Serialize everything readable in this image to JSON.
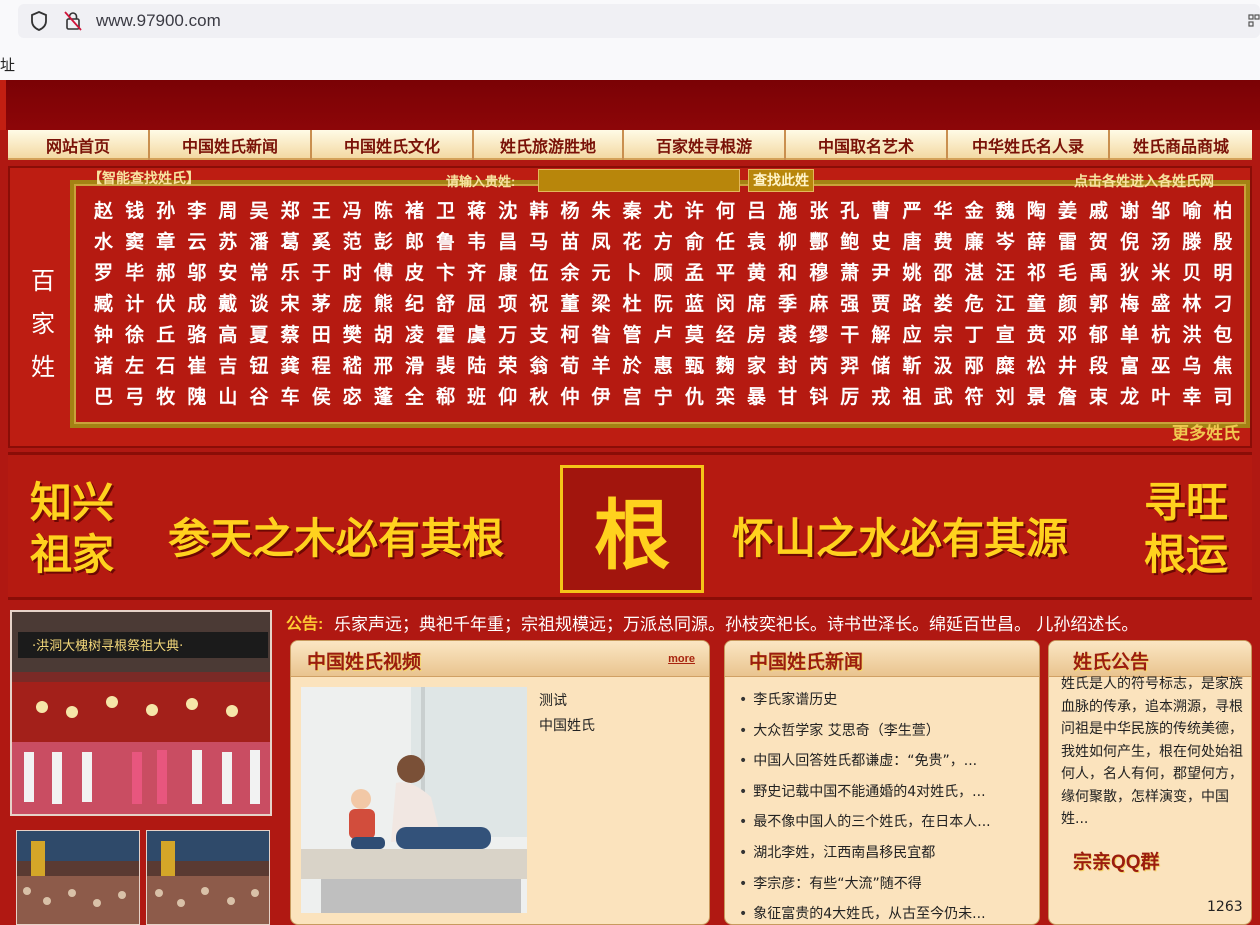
{
  "browser": {
    "url": "www.97900.com",
    "address_label_fragment": "址"
  },
  "nav": {
    "items": [
      "网站首页",
      "中国姓氏新闻",
      "中国姓氏文化",
      "姓氏旅游胜地",
      "百家姓寻根游",
      "中国取名艺术",
      "中华姓氏名人录",
      "姓氏商品商城"
    ]
  },
  "surname": {
    "side_title": [
      "百",
      "家",
      "姓"
    ],
    "search_title": "【智能查找姓氏】",
    "input_label": "请输入贵姓:",
    "input_value": "",
    "search_button": "查找此姓",
    "click_hint": "点击各姓进入各姓氏网",
    "more": "更多姓氏",
    "rows": [
      [
        "赵",
        "钱",
        "孙",
        "李",
        "周",
        "吴",
        "郑",
        "王",
        "冯",
        "陈",
        "褚",
        "卫",
        "蒋",
        "沈",
        "韩",
        "杨",
        "朱",
        "秦",
        "尤",
        "许",
        "何",
        "吕",
        "施",
        "张",
        "孔",
        "曹",
        "严",
        "华",
        "金",
        "魏",
        "陶",
        "姜",
        "戚",
        "谢",
        "邹",
        "喻",
        "柏"
      ],
      [
        "水",
        "窦",
        "章",
        "云",
        "苏",
        "潘",
        "葛",
        "奚",
        "范",
        "彭",
        "郎",
        "鲁",
        "韦",
        "昌",
        "马",
        "苗",
        "凤",
        "花",
        "方",
        "俞",
        "任",
        "袁",
        "柳",
        "酆",
        "鲍",
        "史",
        "唐",
        "费",
        "廉",
        "岑",
        "薛",
        "雷",
        "贺",
        "倪",
        "汤",
        "滕",
        "殷"
      ],
      [
        "罗",
        "毕",
        "郝",
        "邬",
        "安",
        "常",
        "乐",
        "于",
        "时",
        "傅",
        "皮",
        "卞",
        "齐",
        "康",
        "伍",
        "余",
        "元",
        "卜",
        "顾",
        "孟",
        "平",
        "黄",
        "和",
        "穆",
        "萧",
        "尹",
        "姚",
        "邵",
        "湛",
        "汪",
        "祁",
        "毛",
        "禹",
        "狄",
        "米",
        "贝",
        "明"
      ],
      [
        "臧",
        "计",
        "伏",
        "成",
        "戴",
        "谈",
        "宋",
        "茅",
        "庞",
        "熊",
        "纪",
        "舒",
        "屈",
        "项",
        "祝",
        "董",
        "梁",
        "杜",
        "阮",
        "蓝",
        "闵",
        "席",
        "季",
        "麻",
        "强",
        "贾",
        "路",
        "娄",
        "危",
        "江",
        "童",
        "颜",
        "郭",
        "梅",
        "盛",
        "林",
        "刁"
      ],
      [
        "钟",
        "徐",
        "丘",
        "骆",
        "高",
        "夏",
        "蔡",
        "田",
        "樊",
        "胡",
        "凌",
        "霍",
        "虞",
        "万",
        "支",
        "柯",
        "昝",
        "管",
        "卢",
        "莫",
        "经",
        "房",
        "裘",
        "缪",
        "干",
        "解",
        "应",
        "宗",
        "丁",
        "宣",
        "贲",
        "邓",
        "郁",
        "单",
        "杭",
        "洪",
        "包"
      ],
      [
        "诸",
        "左",
        "石",
        "崔",
        "吉",
        "钮",
        "龚",
        "程",
        "嵇",
        "邢",
        "滑",
        "裴",
        "陆",
        "荣",
        "翁",
        "荀",
        "羊",
        "於",
        "惠",
        "甄",
        "麴",
        "家",
        "封",
        "芮",
        "羿",
        "储",
        "靳",
        "汲",
        "邴",
        "糜",
        "松",
        "井",
        "段",
        "富",
        "巫",
        "乌",
        "焦"
      ],
      [
        "巴",
        "弓",
        "牧",
        "隗",
        "山",
        "谷",
        "车",
        "侯",
        "宓",
        "蓬",
        "全",
        "郗",
        "班",
        "仰",
        "秋",
        "仲",
        "伊",
        "宫",
        "宁",
        "仇",
        "栾",
        "暴",
        "甘",
        "钭",
        "厉",
        "戎",
        "祖",
        "武",
        "符",
        "刘",
        "景",
        "詹",
        "束",
        "龙",
        "叶",
        "幸",
        "司"
      ]
    ]
  },
  "banner": {
    "left": [
      "知兴",
      "祖家"
    ],
    "mid_left": "参天之木必有其根",
    "center": "根",
    "mid_right": "怀山之水必有其源",
    "right": [
      "寻旺",
      "根运"
    ]
  },
  "notice": {
    "label": "公告:",
    "text": "乐家声远；典祀千年重；宗祖规模远；万派总同源。孙枝奕祀长。诗书世泽长。绵延百世昌。 儿孙绍述长。"
  },
  "video_panel": {
    "title": "中国姓氏视频",
    "more": "more",
    "links": [
      "测试",
      "中国姓氏"
    ]
  },
  "news_panel": {
    "title": "中国姓氏新闻",
    "items": [
      "李氏家谱历史",
      "大众哲学家 艾思奇（李生萱）",
      "中国人回答姓氏都谦虚：“免贵”，...",
      "野史记载中国不能通婚的4对姓氏，...",
      "最不像中国人的三个姓氏，在日本人...",
      "湖北李姓，江西南昌移民宜都",
      "李宗彦：有些“大流”随不得",
      "象征富贵的4大姓氏，从古至今仍未..."
    ]
  },
  "announce_panel": {
    "title": "姓氏公告",
    "text": "姓氏是人的符号标志，是家族血脉的传承，追本溯源，寻根问祖是中华民族的传统美德，我姓如何产生，根在何处始祖何人，名人有何，郡望何方，缘何聚散，怎样演变，中国姓...",
    "qq": "宗亲QQ群",
    "counter": "1263"
  },
  "colors": {
    "page_bg": "#b01812",
    "gold": "#ffd21e",
    "panel_bg": "#fbe3bd"
  }
}
